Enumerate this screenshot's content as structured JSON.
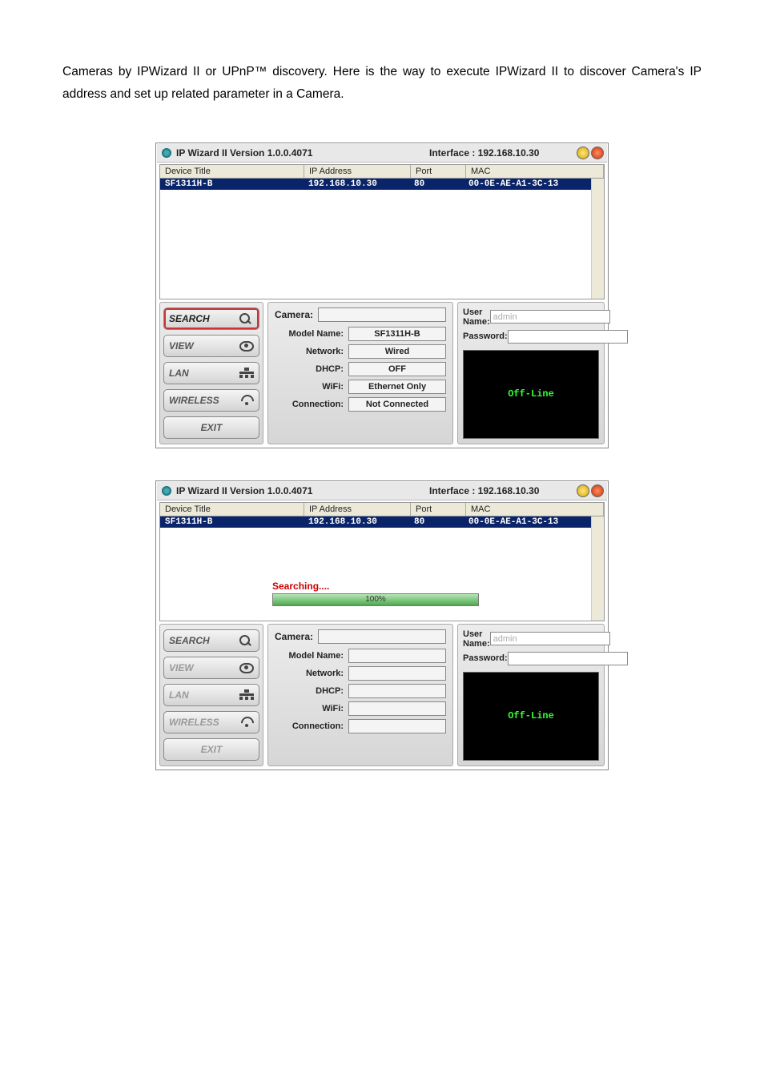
{
  "intro": "Cameras by IPWizard II or UPnP™ discovery. Here is the way to execute IPWizard II to discover Camera's IP address and set up related parameter in a Camera.",
  "app": {
    "title": "IP Wizard II  Version 1.0.0.4071",
    "interface_label": "Interface : 192.168.10.30",
    "columns": {
      "title": "Device Title",
      "ip": "IP Address",
      "port": "Port",
      "mac": "MAC"
    },
    "row": {
      "title": "SF1311H-B",
      "ip": "192.168.10.30",
      "port": "80",
      "mac": "00-0E-AE-A1-3C-13"
    },
    "nav": {
      "search": "SEARCH",
      "view": "VIEW",
      "lan": "LAN",
      "wireless": "WIRELESS",
      "exit": "EXIT"
    },
    "camera_label": "Camera:",
    "fields": {
      "model_name": {
        "label": "Model Name:",
        "value1": "SF1311H-B",
        "value2": ""
      },
      "network": {
        "label": "Network:",
        "value1": "Wired",
        "value2": ""
      },
      "dhcp": {
        "label": "DHCP:",
        "value1": "OFF",
        "value2": ""
      },
      "wifi": {
        "label": "WiFi:",
        "value1": "Ethernet Only",
        "value2": ""
      },
      "connection": {
        "label": "Connection:",
        "value1": "Not Connected",
        "value2": ""
      }
    },
    "auth": {
      "user_label": "User Name:",
      "user_value": "admin",
      "pass_label": "Password:"
    },
    "status": "Off-Line",
    "searching": {
      "label": "Searching....",
      "percent": "100%"
    }
  }
}
